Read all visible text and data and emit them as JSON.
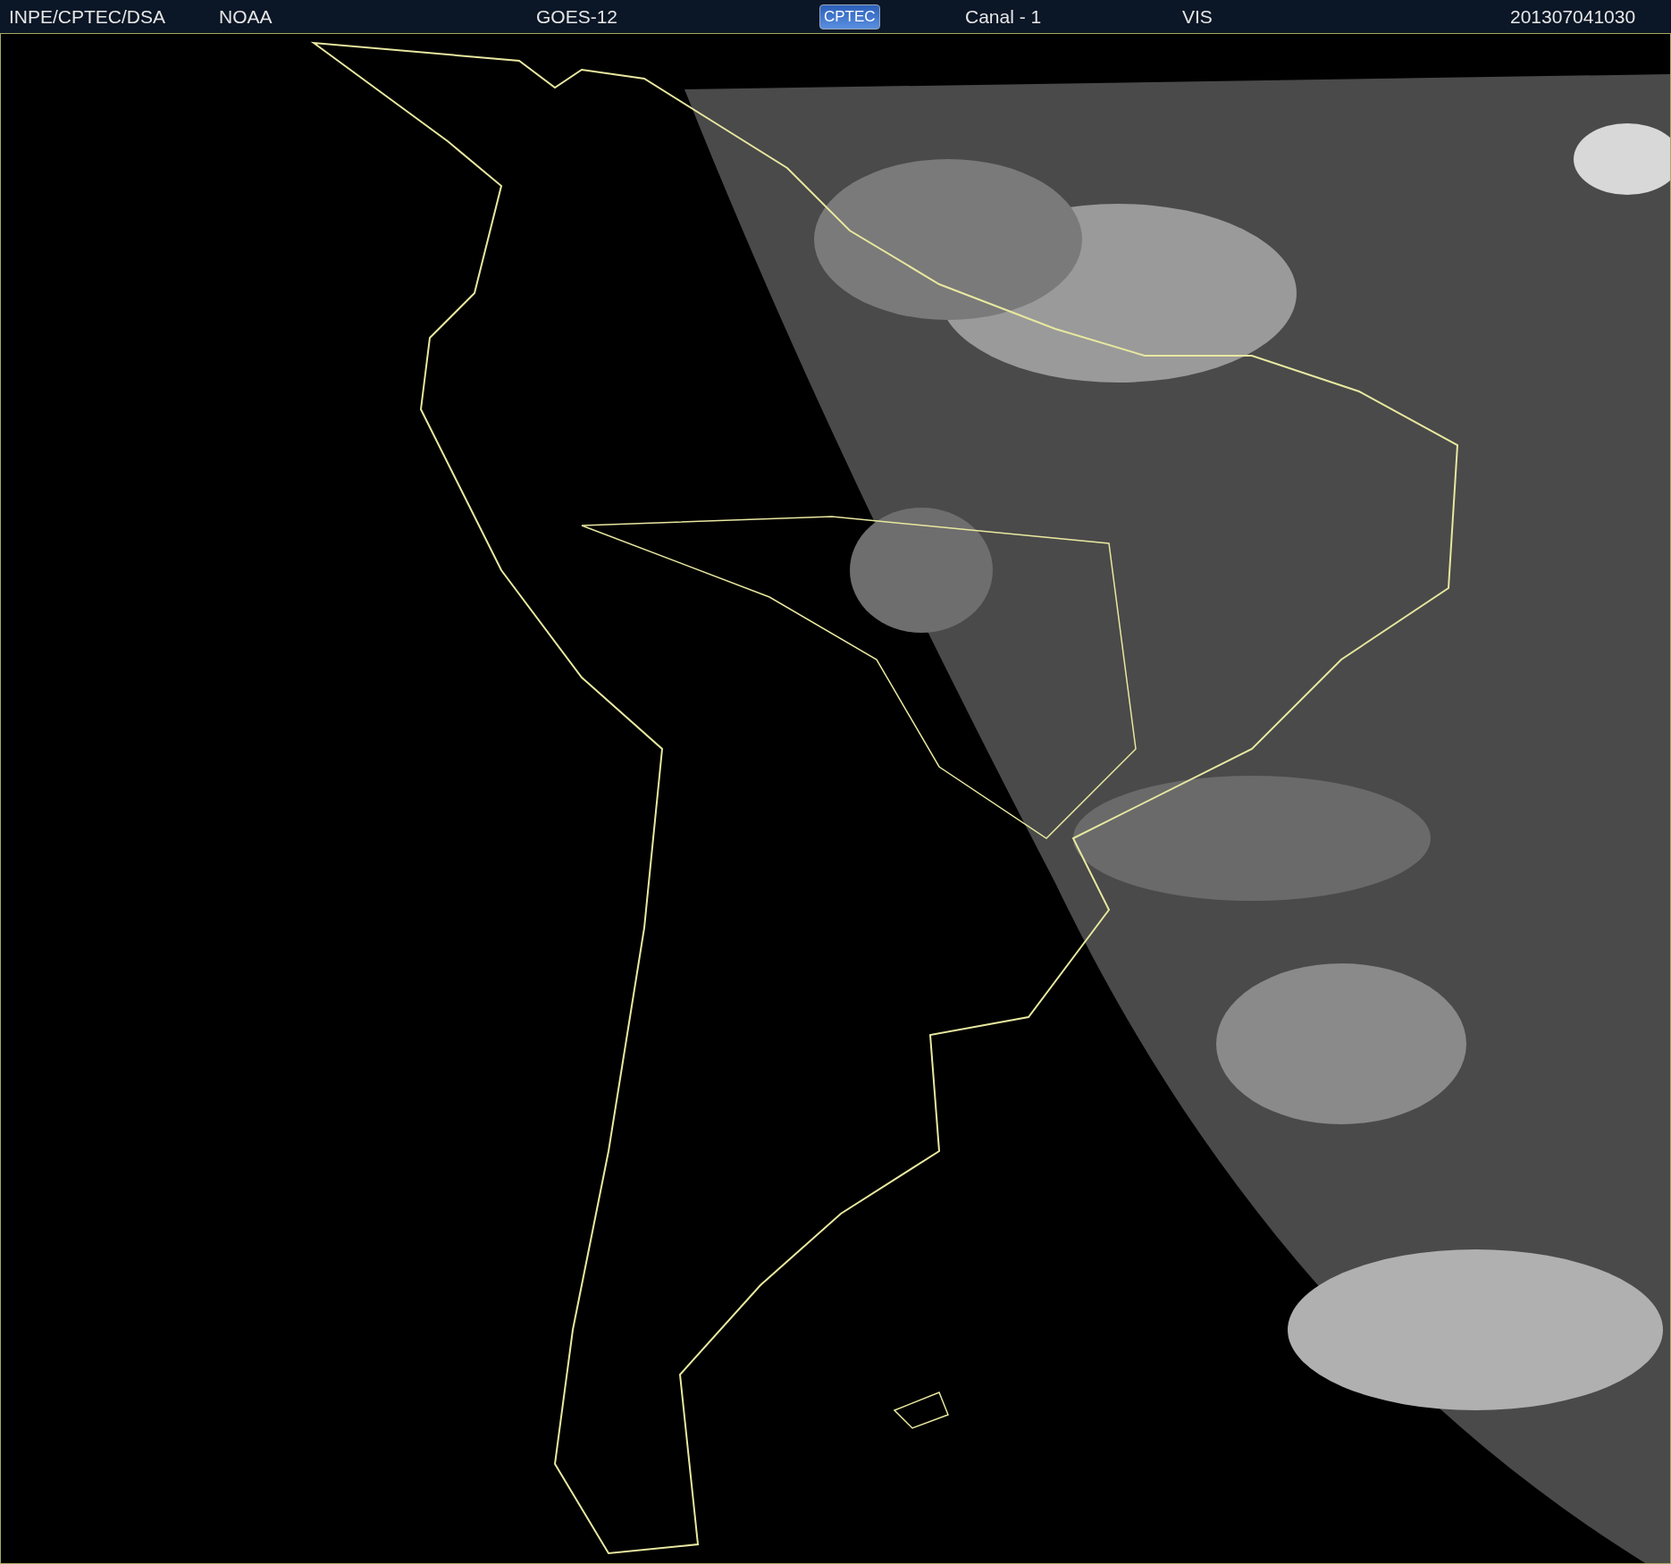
{
  "header": {
    "items": [
      {
        "kind": "text",
        "text": "INPE/CPTEC/DSA"
      },
      {
        "kind": "text",
        "text": "NOAA"
      },
      {
        "kind": "text",
        "text": "GOES-12"
      },
      {
        "kind": "logo",
        "text": "CPTEC"
      },
      {
        "kind": "text",
        "text": "Canal - 1"
      },
      {
        "kind": "text",
        "text": "VIS"
      },
      {
        "kind": "text",
        "text": "201307041030"
      }
    ]
  }
}
